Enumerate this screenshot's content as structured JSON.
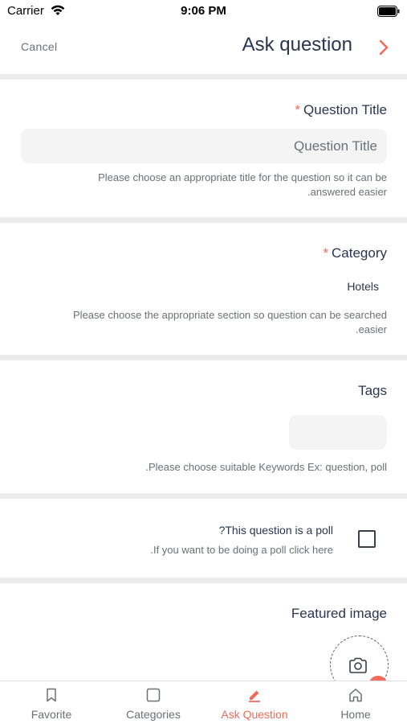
{
  "status_bar": {
    "carrier": "Carrier",
    "time": "9:06 PM"
  },
  "nav": {
    "cancel": "Cancel",
    "title": "Ask question",
    "next_icon": "chevron-right-icon"
  },
  "question_title": {
    "required_mark": "*",
    "label": "Question Title",
    "placeholder": "Question Title",
    "hint_line1": "Please choose an appropriate title for the question so it can be",
    "hint_line2": ".answered easier"
  },
  "category": {
    "required_mark": "*",
    "label": "Category",
    "value": "Hotels",
    "hint_line1": "Please choose the appropriate section so question can be searched",
    "hint_line2": ".easier"
  },
  "tags": {
    "label": "Tags",
    "hint": ".Please choose suitable Keywords Ex: question, poll"
  },
  "poll": {
    "label": "?This question is a poll",
    "hint": ".If you want to be doing a poll click here",
    "checked": false
  },
  "featured_image": {
    "label": "Featured image",
    "icon": "camera-icon"
  },
  "tab_bar": {
    "items": [
      {
        "label": "Favorite",
        "icon": "bookmark-icon"
      },
      {
        "label": "Categories",
        "icon": "square-icon"
      },
      {
        "label": "Ask Question",
        "icon": "pencil-icon",
        "active": true
      },
      {
        "label": "Home",
        "icon": "home-icon"
      }
    ]
  },
  "colors": {
    "accent": "#f26b5b",
    "text_dark": "#2a3550",
    "text_muted": "#6b6f78",
    "divider": "#ececec"
  }
}
